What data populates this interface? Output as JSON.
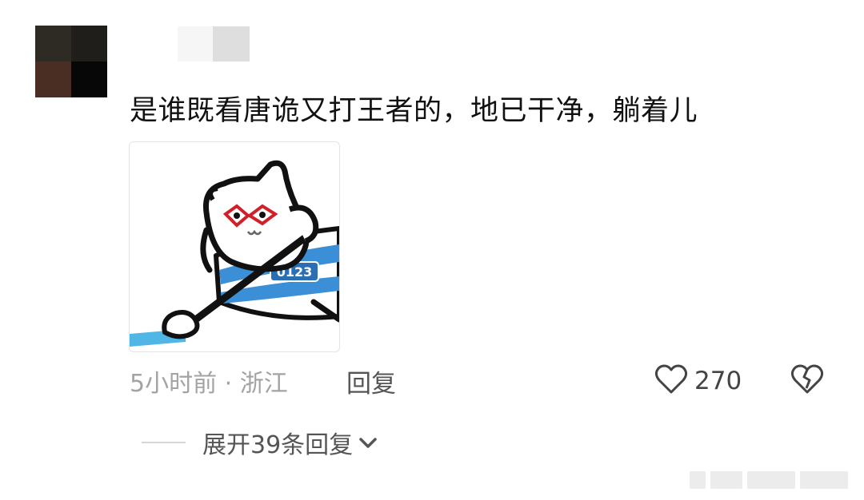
{
  "comment": {
    "text": "是谁既看唐诡又打王者的，地已干净，躺着儿",
    "sticker_text": "0123",
    "meta": "5小时前 · 浙江",
    "reply_label": "回复",
    "like_count": "270",
    "expand_label": "展开39条回复"
  },
  "icons": {
    "like": "heart-outline-icon",
    "dislike": "broken-heart-icon",
    "expand": "chevron-down-icon"
  },
  "colors": {
    "text_primary": "#111111",
    "text_meta": "#a3a3a3",
    "text_secondary": "#555555",
    "sticker_stripe": "#3b8fd6",
    "sticker_glasses": "#d0202a"
  }
}
